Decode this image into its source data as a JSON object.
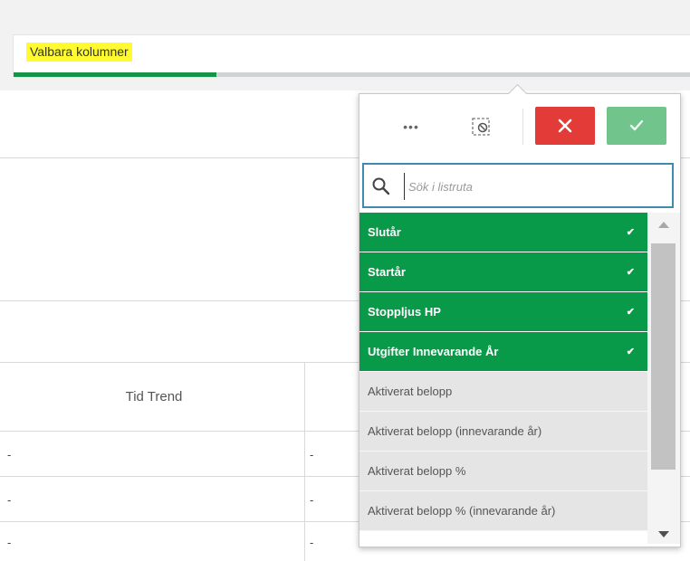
{
  "filter": {
    "title": "Valbara kolumner",
    "selection_progress": 0.3
  },
  "table": {
    "columns": [
      "Tid Trend"
    ],
    "rows": [
      [
        "-",
        "-"
      ],
      [
        "-",
        "-"
      ],
      [
        "-",
        "-"
      ]
    ]
  },
  "popover": {
    "toolbar": {
      "more_icon": "more-icon",
      "clear_icon": "clear-selection-icon",
      "cancel_icon": "close-icon",
      "confirm_icon": "check-icon",
      "cancel_color": "#e23b38",
      "confirm_color": "#70c48c"
    },
    "search": {
      "placeholder": "Sök i listruta",
      "value": ""
    },
    "items": [
      {
        "label": "Slutår",
        "selected": true
      },
      {
        "label": "Startår",
        "selected": true
      },
      {
        "label": "Stoppljus HP",
        "selected": true
      },
      {
        "label": "Utgifter Innevarande År",
        "selected": true
      },
      {
        "label": "Aktiverat belopp",
        "selected": false
      },
      {
        "label": "Aktiverat belopp (innevarande år)",
        "selected": false
      },
      {
        "label": "Aktiverat belopp %",
        "selected": false
      },
      {
        "label": "Aktiverat belopp % (innevarande år)",
        "selected": false
      }
    ]
  },
  "colors": {
    "selected": "#089a48",
    "highlight": "#fffb2e",
    "progress": "#159447"
  }
}
